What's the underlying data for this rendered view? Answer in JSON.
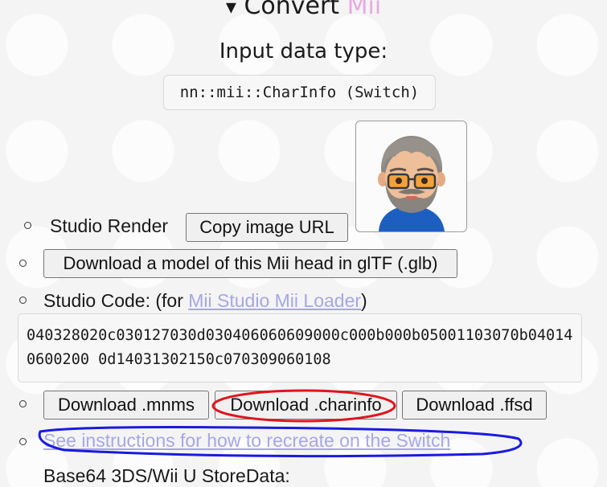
{
  "heading": {
    "triangle": "▾",
    "text": "Convert ",
    "accent": "Mii"
  },
  "input_type": {
    "label": "Input data type:",
    "value": "nn::mii::CharInfo (Switch)"
  },
  "studio_render": {
    "label": "Studio Render",
    "button": "Copy image URL"
  },
  "download_model": {
    "button": "Download a model of this Mii head in glTF (.glb)"
  },
  "studio_code": {
    "label": "Studio Code: (for ",
    "link": "Mii Studio Mii Loader",
    "suffix": ")",
    "value": "040328020c030127030d030406060609000c000b000b05001103070b040140600200 0d14031302150c070309060108"
  },
  "downloads": {
    "mnms": "Download .mnms",
    "charinfo": "Download .charinfo",
    "ffsd": "Download .ffsd"
  },
  "instructions_link": "See instructions for how to recreate on the Switch",
  "base64_label": "Base64 3DS/Wii U StoreData:",
  "colors": {
    "accent": "#e7a9e3",
    "link": "#a6a7e6",
    "annotation_red": "#e0141e",
    "annotation_blue": "#1a1ae0"
  }
}
